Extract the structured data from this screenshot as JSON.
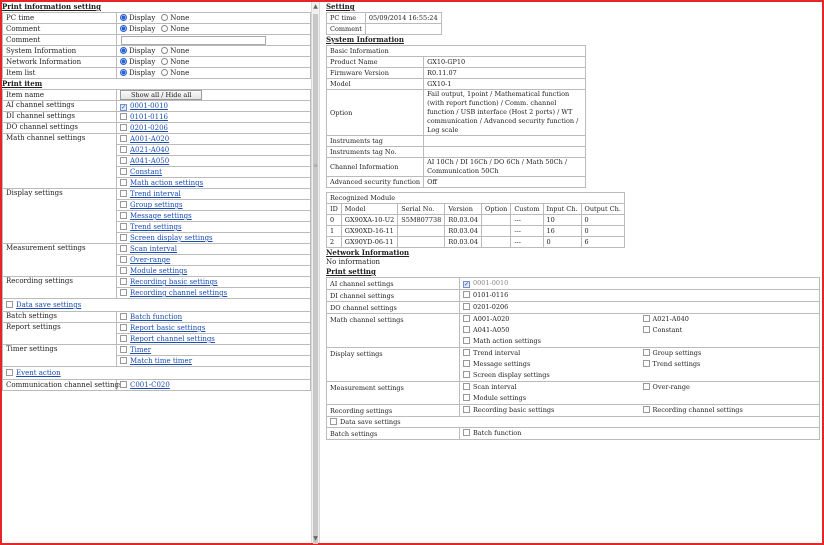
{
  "left": {
    "print_info_title": "Print information setting",
    "display_label": "Display",
    "none_label": "None",
    "rows": [
      {
        "label": "PC time",
        "display": true
      },
      {
        "label": "Comment",
        "display": true
      },
      {
        "label": "System Information",
        "display": true
      },
      {
        "label": "Network Information",
        "display": true
      },
      {
        "label": "Item list",
        "display": true
      }
    ],
    "comment_label": "Comment",
    "print_item_title": "Print item",
    "item_name_header": "Item name",
    "show_hide_label": "Show all / Hide all",
    "groups": [
      {
        "label": "AI channel settings",
        "links": [
          "0001-0010"
        ],
        "checked": [
          true
        ]
      },
      {
        "label": "DI channel settings",
        "links": [
          "0101-0116"
        ],
        "checked": [
          false
        ]
      },
      {
        "label": "DO channel settings",
        "links": [
          "0201-0206"
        ],
        "checked": [
          false
        ]
      },
      {
        "label": "Math channel settings",
        "links": [
          "A001-A020",
          "A021-A040",
          "A041-A050",
          "Constant",
          "Math action settings"
        ],
        "checked": [
          false,
          false,
          false,
          false,
          false
        ]
      },
      {
        "label": "Display settings",
        "links": [
          "Trend interval",
          "Group settings",
          "Message settings",
          "Trend settings",
          "Screen display settings"
        ],
        "checked": [
          false,
          false,
          false,
          false,
          false
        ]
      },
      {
        "label": "Measurement settings",
        "links": [
          "Scan interval",
          "Over-range",
          "Module settings"
        ],
        "checked": [
          false,
          false,
          false
        ]
      },
      {
        "label": "Recording settings",
        "links": [
          "Recording basic settings",
          "Recording channel settings"
        ],
        "checked": [
          false,
          false
        ]
      }
    ],
    "data_save_label": "Data save settings",
    "groups2": [
      {
        "label": "Batch settings",
        "links": [
          "Batch function"
        ]
      },
      {
        "label": "Report settings",
        "links": [
          "Report basic settings",
          "Report channel settings"
        ]
      },
      {
        "label": "Timer settings",
        "links": [
          "Timer",
          "Match time timer"
        ]
      }
    ],
    "event_action_label": "Event action",
    "comm_label": "Communication channel settings",
    "comm_link": "C001-C020"
  },
  "right": {
    "setting_title": "Setting",
    "pc_time_label": "PC time",
    "pc_time_value": "05/09/2014 16:55:24",
    "comment_label": "Comment",
    "sysinfo_title": "System Information",
    "basic_info": "Basic Information",
    "info_rows": [
      {
        "k": "Product Name",
        "v": "GX10-GP10"
      },
      {
        "k": "Firmware Version",
        "v": "R0.11.07"
      },
      {
        "k": "Model",
        "v": "GX10-1"
      },
      {
        "k": "Option",
        "v": "Fail output, 1point / Mathematical function (with report function) / Comm. channel function / USB interface (Host 2 ports) / WT communication / Advanced security function / Log scale"
      },
      {
        "k": "Instruments tag",
        "v": ""
      },
      {
        "k": "Instruments tag No.",
        "v": ""
      },
      {
        "k": "Channel Information",
        "v": "AI 10Ch / DI 16Ch / DO 6Ch / Math 50Ch / Communication 50Ch"
      },
      {
        "k": "Advanced security function",
        "v": "Off"
      }
    ],
    "recognized_module": "Recognized Module",
    "module_headers": [
      "ID",
      "Model",
      "Serial No.",
      "Version",
      "Option",
      "Custom",
      "Input Ch.",
      "Output Ch."
    ],
    "modules": [
      [
        "0",
        "GX90XA-10-U2",
        "S5M807738",
        "R0.03.04",
        "",
        "---",
        "10",
        "0"
      ],
      [
        "1",
        "GX90XD-16-11",
        "",
        "R0.03.04",
        "",
        "---",
        "16",
        "0"
      ],
      [
        "2",
        "GX90YD-06-11",
        "",
        "R0.03.04",
        "",
        "---",
        "0",
        "6"
      ]
    ],
    "netinfo_title": "Network Information",
    "no_info": "No information",
    "print_setting_title": "Print setting",
    "ps_rows": [
      {
        "k": "AI channel settings",
        "cells": [
          {
            "t": "0001-0010",
            "on": true,
            "dis": true,
            "full": true
          }
        ]
      },
      {
        "k": "DI channel settings",
        "cells": [
          {
            "t": "0101-0116",
            "full": true
          }
        ]
      },
      {
        "k": "DO channel settings",
        "cells": [
          {
            "t": "0201-0206",
            "full": true
          }
        ]
      },
      {
        "k": "Math channel settings",
        "cells": [
          {
            "t": "A001-A020"
          },
          {
            "t": "A021-A040"
          },
          {
            "t": "A041-A050"
          },
          {
            "t": "Constant"
          },
          {
            "t": "Math action settings",
            "full": true
          }
        ]
      },
      {
        "k": "Display settings",
        "cells": [
          {
            "t": "Trend interval"
          },
          {
            "t": "Group settings"
          },
          {
            "t": "Message settings"
          },
          {
            "t": "Trend settings"
          },
          {
            "t": "Screen display settings",
            "full": true
          }
        ]
      },
      {
        "k": "Measurement settings",
        "cells": [
          {
            "t": "Scan interval"
          },
          {
            "t": "Over-range"
          },
          {
            "t": "Module settings",
            "full": true
          }
        ]
      },
      {
        "k": "Recording settings",
        "cells": [
          {
            "t": "Recording basic settings"
          },
          {
            "t": "Recording channel settings"
          }
        ]
      }
    ],
    "data_save_label": "Data save settings",
    "batch_label": "Batch settings",
    "batch_cell": "Batch function"
  },
  "colors": {
    "frame": "#e52626",
    "link": "#1a4db3",
    "radio_on": "#2962d6"
  }
}
